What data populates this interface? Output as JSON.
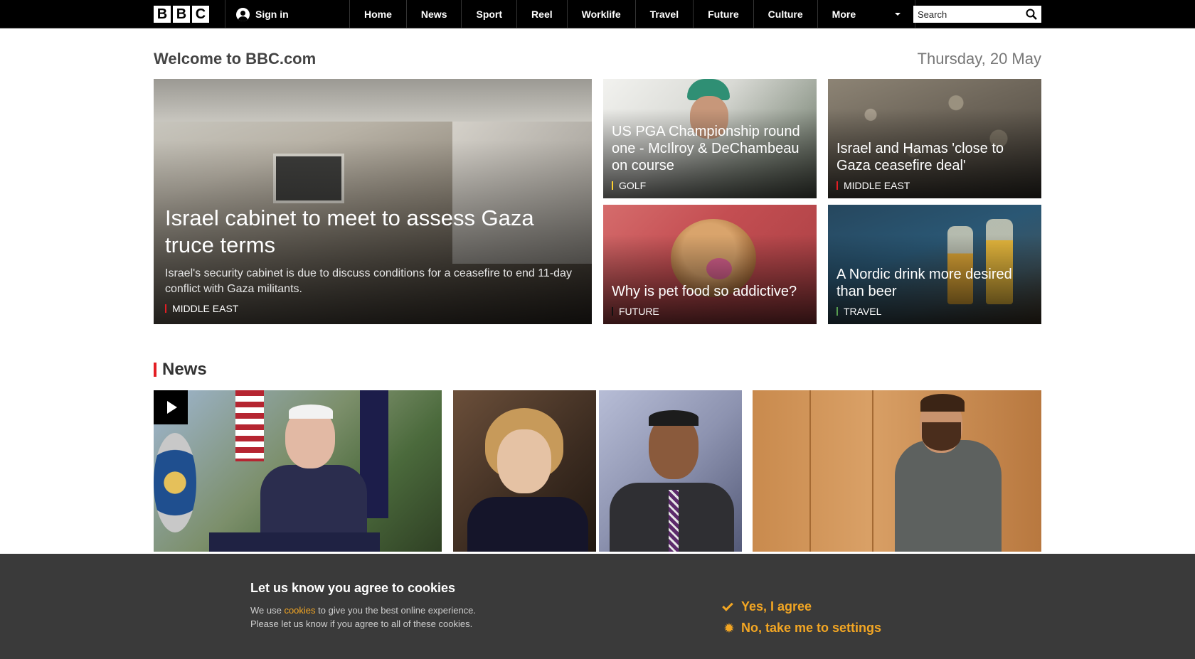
{
  "header": {
    "logo_letters": [
      "B",
      "B",
      "C"
    ],
    "signin_label": "Sign in",
    "nav": [
      "Home",
      "News",
      "Sport",
      "Reel",
      "Worklife",
      "Travel",
      "Future",
      "Culture"
    ],
    "more_label": "More",
    "search_placeholder": "Search"
  },
  "welcome": {
    "title": "Welcome to BBC.com",
    "date": "Thursday, 20 May"
  },
  "hero": {
    "headline": "Israel cabinet to meet to assess Gaza truce terms",
    "summary": "Israel's security cabinet is due to discuss conditions for a ceasefire to end 11-day conflict with Gaza militants.",
    "tag": "MIDDLE EAST",
    "tag_color": "#e31e24"
  },
  "cards": [
    {
      "headline": "US PGA Championship round one - McIlroy & DeChambeau on course",
      "tag": "GOLF",
      "tag_color": "#ffd230"
    },
    {
      "headline": "Israel and Hamas 'close to Gaza ceasefire deal'",
      "tag": "MIDDLE EAST",
      "tag_color": "#e31e24"
    },
    {
      "headline": "Why is pet food so addictive?",
      "tag": "FUTURE",
      "tag_color": "#111111"
    },
    {
      "headline": "A Nordic drink more desired than beer",
      "tag": "TRAVEL",
      "tag_color": "#589e50"
    }
  ],
  "news_section": {
    "title": "News",
    "accent": "#e31e24"
  },
  "cookie_banner": {
    "title": "Let us know you agree to cookies",
    "line1_pre": "We use ",
    "line1_link": "cookies",
    "line1_post": " to give you the best online experience.",
    "line2": "Please let us know if you agree to all of these cookies.",
    "agree_label": "Yes, I agree",
    "settings_label": "No, take me to settings",
    "accent": "#f3a623"
  }
}
